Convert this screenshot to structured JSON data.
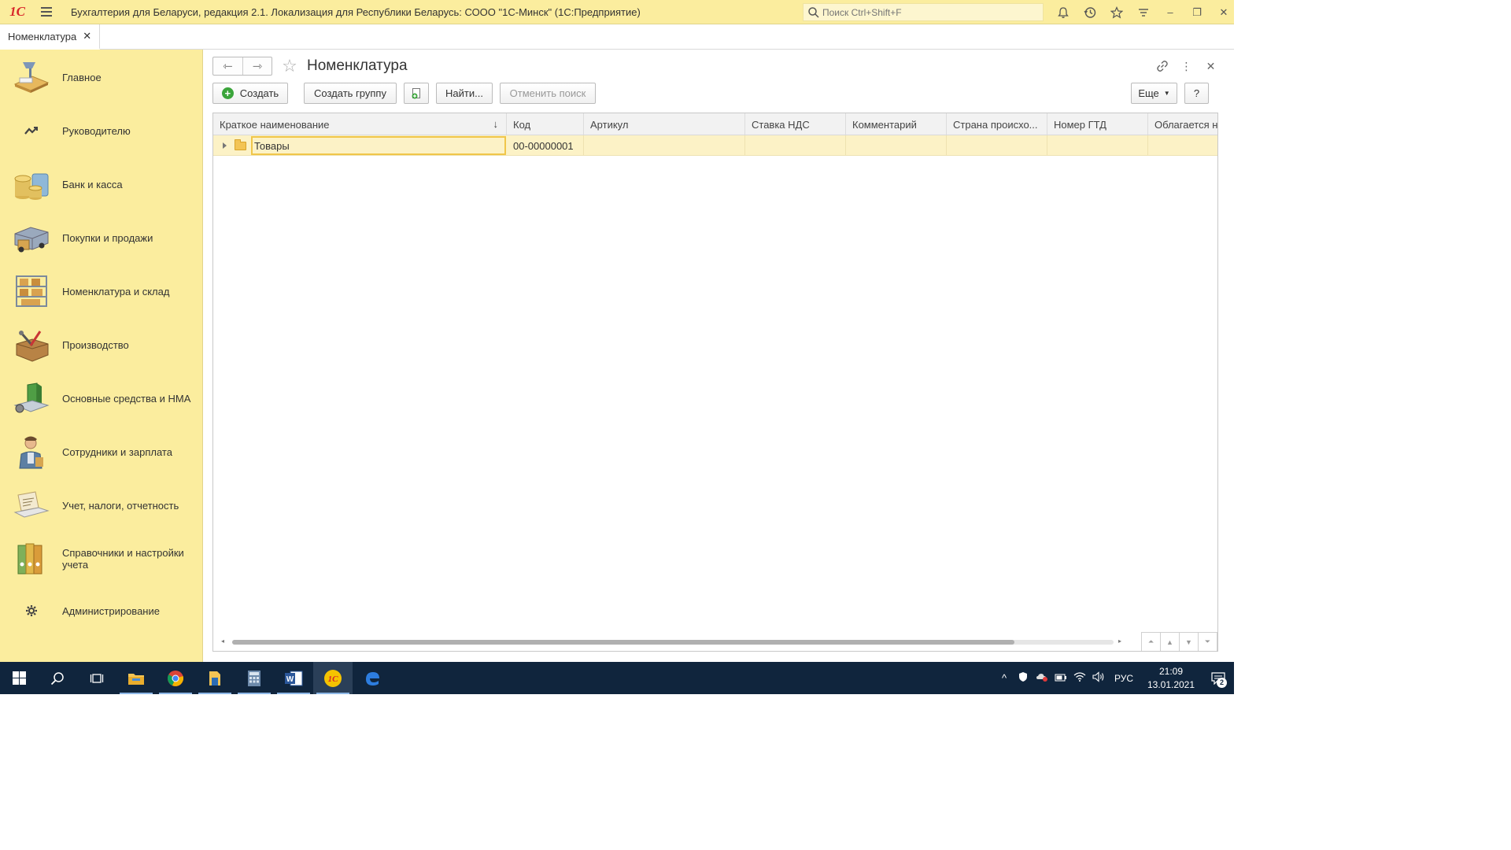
{
  "titlebar": {
    "logo": "1С",
    "title": "Бухгалтерия для Беларуси, редакция 2.1. Локализация для Республики Беларусь: СООО \"1С-Минск\"  (1С:Предприятие)",
    "search_placeholder": "Поиск Ctrl+Shift+F"
  },
  "tabs": [
    {
      "label": "Номенклатура",
      "close": "✕"
    }
  ],
  "sidebar": {
    "items": [
      {
        "label": "Главное",
        "icon": "desk-lamp-icon"
      },
      {
        "label": "Руководителю",
        "icon": "trend-line-icon"
      },
      {
        "label": "Банк и касса",
        "icon": "coins-icon"
      },
      {
        "label": "Покупки и продажи",
        "icon": "delivery-truck-icon"
      },
      {
        "label": "Номенклатура и склад",
        "icon": "warehouse-shelf-icon"
      },
      {
        "label": "Производство",
        "icon": "toolbox-icon"
      },
      {
        "label": "Основные средства и НМА",
        "icon": "machinery-icon"
      },
      {
        "label": "Сотрудники и зарплата",
        "icon": "worker-icon"
      },
      {
        "label": "Учет, налоги, отчетность",
        "icon": "laptop-icon"
      },
      {
        "label": "Справочники и настройки учета",
        "icon": "binders-icon"
      },
      {
        "label": "Администрирование",
        "icon": "gear-icon"
      }
    ]
  },
  "form": {
    "title": "Номенклатура",
    "buttons": {
      "create": "Создать",
      "create_group": "Создать группу",
      "find": "Найти...",
      "cancel_search": "Отменить поиск",
      "more": "Еще",
      "help": "?"
    }
  },
  "grid": {
    "columns": [
      "Краткое наименование",
      "Код",
      "Артикул",
      "Ставка НДС",
      "Комментарий",
      "Страна происхо...",
      "Номер ГТД",
      "Облагается н"
    ],
    "sort_indicator": "↓",
    "rows": [
      {
        "name": "Товары",
        "code": "00-00000001",
        "article": "",
        "vat": "",
        "comment": "",
        "country": "",
        "gtd": "",
        "taxed": ""
      }
    ]
  },
  "taskbar": {
    "lang": "РУС",
    "time": "21:09",
    "date": "13.01.2021",
    "notifications": "2"
  },
  "colors": {
    "accent_yellow": "#fbed9e",
    "row_selected": "#fcf2c6",
    "brand_red": "#d8262a",
    "taskbar": "#10253d"
  }
}
